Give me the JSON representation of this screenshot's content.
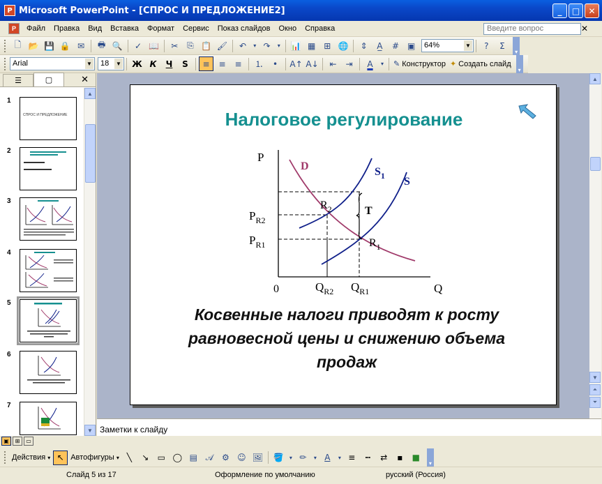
{
  "window": {
    "title": "Microsoft PowerPoint - [СПРОС И ПРЕДЛОЖЕНИЕ2]",
    "app_icon": "P"
  },
  "menu": {
    "items": [
      "Файл",
      "Правка",
      "Вид",
      "Вставка",
      "Формат",
      "Сервис",
      "Показ слайдов",
      "Окно",
      "Справка"
    ],
    "help_placeholder": "Введите вопрос"
  },
  "toolbar": {
    "zoom": "64%"
  },
  "format_toolbar": {
    "font": "Arial",
    "size": "18",
    "bold": "Ж",
    "italic": "К",
    "underline": "Ч",
    "shadow": "S",
    "designer": "Конструктор",
    "new_slide": "Создать слайд"
  },
  "slides_panel": {
    "thumbnails": [
      {
        "num": "1",
        "caption": "СПРОС И ПРЕДЛОЖЕНИЕ"
      },
      {
        "num": "2",
        "caption": ""
      },
      {
        "num": "3",
        "caption": ""
      },
      {
        "num": "4",
        "caption": ""
      },
      {
        "num": "5",
        "caption": ""
      },
      {
        "num": "6",
        "caption": ""
      },
      {
        "num": "7",
        "caption": ""
      }
    ]
  },
  "slide": {
    "title": "Налоговое регулирование",
    "body": "Косвенные налоги приводят к росту равновесной цены и снижению объема продаж",
    "graph_labels": {
      "p": "P",
      "q": "Q",
      "zero": "0",
      "d": "D",
      "s": "S",
      "s1": "S",
      "s1_sub": "1",
      "t": "T",
      "r1": "R",
      "r1_sub": "1",
      "r2": "R",
      "r2_sub": "2",
      "pr1": "P",
      "pr1_sub": "R1",
      "pr2": "P",
      "pr2_sub": "R2",
      "qr1": "Q",
      "qr1_sub": "R1",
      "qr2": "Q",
      "qr2_sub": "R2"
    }
  },
  "notes": {
    "placeholder": "Заметки к слайду"
  },
  "drawing_toolbar": {
    "actions": "Действия",
    "autoshapes": "Автофигуры"
  },
  "status": {
    "slide": "Слайд 5 из 17",
    "design": "Оформление по умолчанию",
    "language": "русский (Россия)"
  },
  "colors": {
    "title": "#159090",
    "demand_curve": "#a03a6a",
    "supply_curve": "#10208a"
  }
}
